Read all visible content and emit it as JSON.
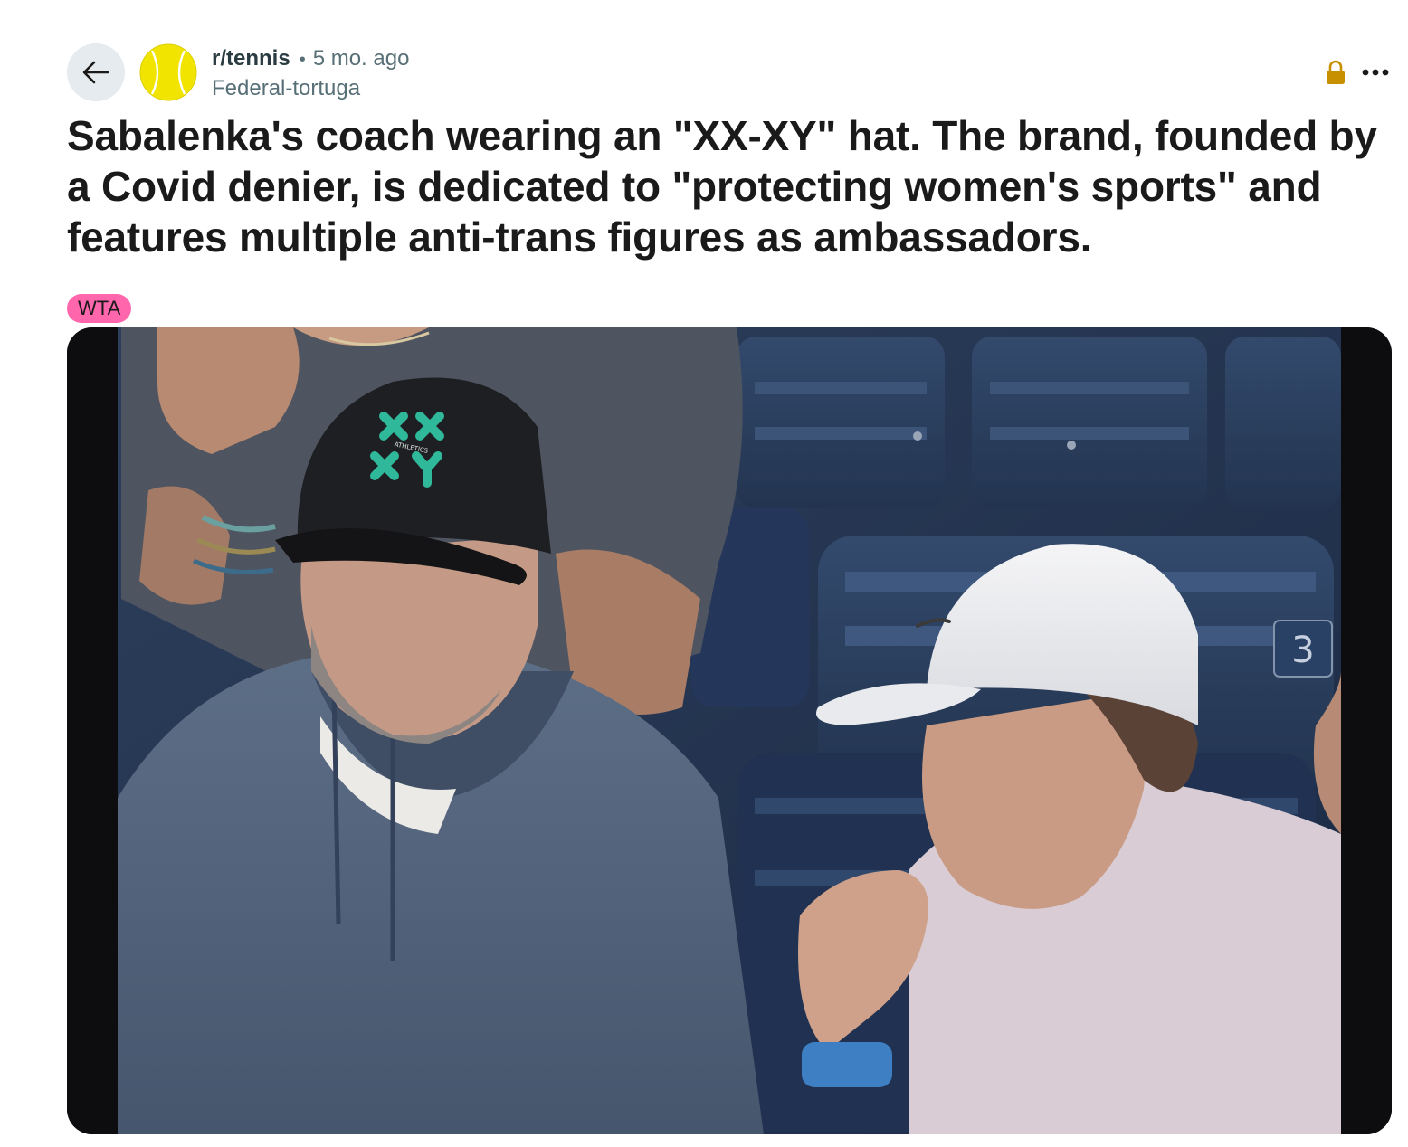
{
  "header": {
    "back_icon": "arrow-left-icon",
    "subreddit": "r/tennis",
    "separator": "•",
    "age": "5 mo. ago",
    "author": "Federal-tortuga",
    "lock_icon": "lock-icon",
    "lock_color": "#c69000",
    "more_icon": "more-horizontal-icon"
  },
  "post": {
    "title": "Sabalenka's coach wearing an \"XX-XY\" hat. The brand, founded by a Covid denier, is dedicated to \"protecting women's sports\" and features multiple anti-trans figures as ambassadors.",
    "flair": "WTA",
    "flair_color": "#ff66ac"
  },
  "media": {
    "hat_logo_text": "ATHLETICS",
    "seat_number": "3"
  }
}
